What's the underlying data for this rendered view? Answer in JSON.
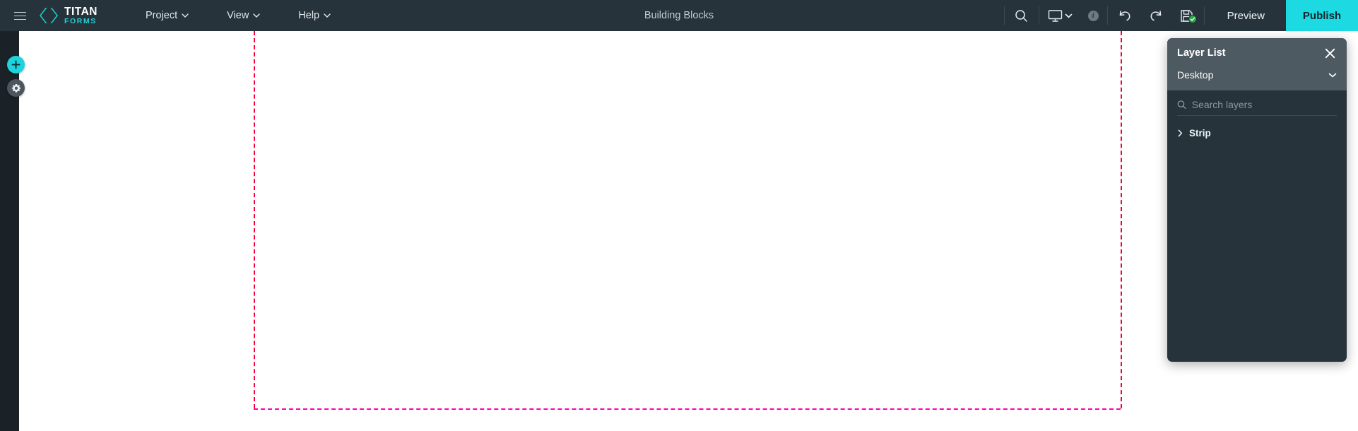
{
  "topbar": {
    "menu_icon": "hamburger-icon",
    "brand": {
      "logo_icon": "titan-logo-icon",
      "name": "TITAN",
      "subtitle": "FORMS"
    },
    "menus": [
      {
        "label": "Project",
        "icon": "chevron-down-icon"
      },
      {
        "label": "View",
        "icon": "chevron-down-icon"
      },
      {
        "label": "Help",
        "icon": "chevron-down-icon"
      }
    ],
    "document_title": "Building Blocks",
    "actions": {
      "search_icon": "search-icon",
      "device_icon": "desktop-monitor-icon",
      "device_caret_icon": "chevron-down-icon",
      "info_badge": "i",
      "undo_icon": "undo-arrow-icon",
      "redo_icon": "redo-arrow-icon",
      "save_icon": "save-disk-icon",
      "save_status_icon": "check-circle-icon",
      "preview_label": "Preview",
      "publish_label": "Publish"
    }
  },
  "left_rail": {
    "add_button_icon": "plus-icon",
    "settings_button_icon": "gear-icon"
  },
  "canvas": {
    "page_edge_color": "#f7003c",
    "page_bottom_color": "#ff00b0"
  },
  "layer_panel": {
    "title": "Layer List",
    "close_icon": "close-x-icon",
    "device_selector": {
      "value": "Desktop",
      "caret_icon": "chevron-down-icon"
    },
    "search": {
      "icon": "search-icon",
      "value": "",
      "placeholder": "Search layers"
    },
    "layers": [
      {
        "name": "Strip",
        "expand_icon": "chevron-right-icon",
        "expanded": false
      }
    ]
  },
  "colors": {
    "topbar_bg": "#26333b",
    "rail_bg": "#1b2227",
    "panel_bg": "#26333b",
    "panel_head_bg": "#4e5a61",
    "accent": "#1cd9e2",
    "brand_accent": "#26cfd6",
    "save_ok": "#27a745"
  }
}
